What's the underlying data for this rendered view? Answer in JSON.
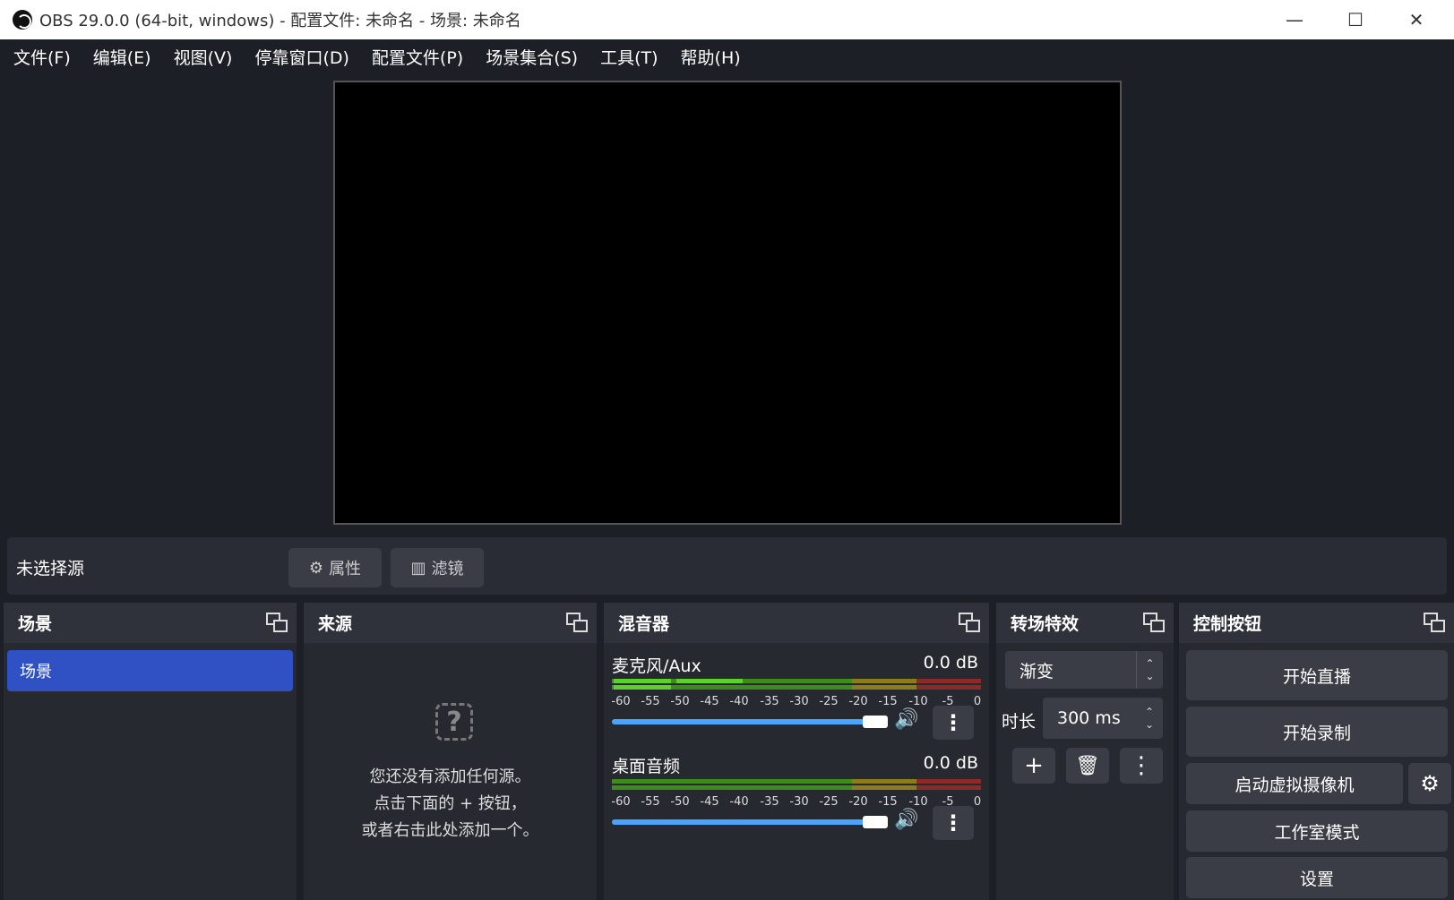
{
  "window": {
    "title": "OBS 29.0.0 (64-bit, windows) - 配置文件: 未命名 - 场景: 未命名",
    "minimize": "—",
    "maximize": "☐",
    "close": "✕"
  },
  "menu": [
    "文件(F)",
    "编辑(E)",
    "视图(V)",
    "停靠窗口(D)",
    "配置文件(P)",
    "场景集合(S)",
    "工具(T)",
    "帮助(H)"
  ],
  "source_toolbar": {
    "no_selection": "未选择源",
    "properties": "属性",
    "filters": "滤镜"
  },
  "scenes": {
    "title": "场景",
    "items": [
      "场景"
    ]
  },
  "sources": {
    "title": "来源",
    "empty_line1": "您还没有添加任何源。",
    "empty_line2": "点击下面的 + 按钮，",
    "empty_line3": "或者右击此处添加一个。"
  },
  "mixer": {
    "title": "混音器",
    "scale": [
      "-60",
      "-55",
      "-50",
      "-45",
      "-40",
      "-35",
      "-30",
      "-25",
      "-20",
      "-15",
      "-10",
      "-5",
      "0"
    ],
    "channels": [
      {
        "name": "麦克风/Aux",
        "db": "0.0 dB",
        "volume": 1.0
      },
      {
        "name": "桌面音频",
        "db": "0.0 dB",
        "volume": 1.0
      }
    ],
    "colors": {
      "green": "#3d8c1c",
      "yellow": "#8c7c1c",
      "red": "#8c2a2a",
      "bright_green": "#5cd12a"
    }
  },
  "transitions": {
    "title": "转场特效",
    "selected": "渐变",
    "duration_label": "时长",
    "duration_value": "300 ms"
  },
  "controls": {
    "title": "控制按钮",
    "start_stream": "开始直播",
    "start_record": "开始录制",
    "virtual_cam": "启动虚拟摄像机",
    "studio_mode": "工作室模式",
    "settings": "设置"
  },
  "accent_color": "#2f51c4"
}
